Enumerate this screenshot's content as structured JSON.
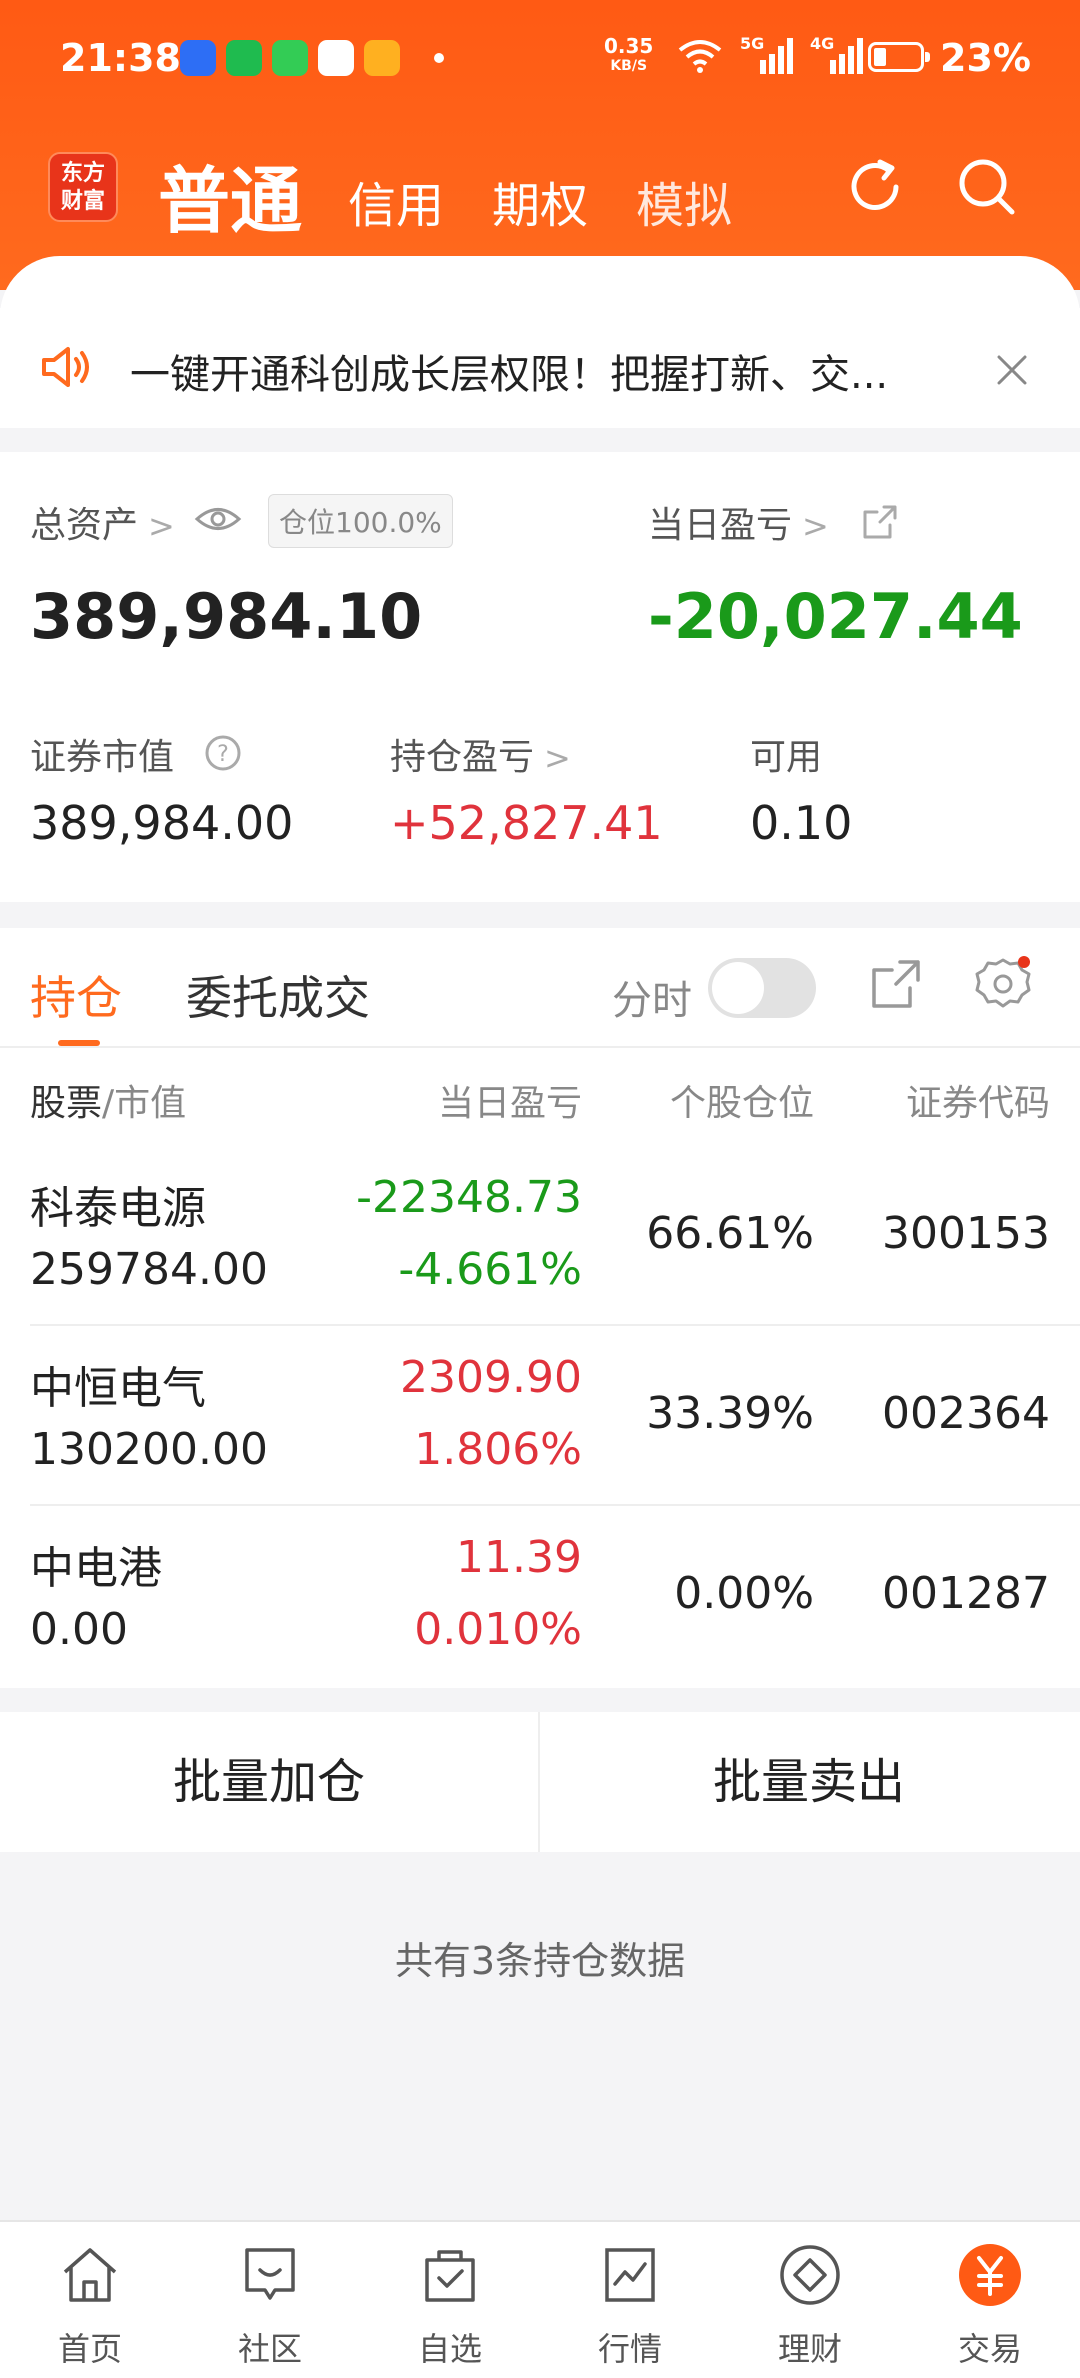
{
  "status": {
    "time": "21:38",
    "net_speed": "0.35",
    "net_unit": "KB/S",
    "sig1": "5G",
    "sig2": "4G",
    "battery": "23%"
  },
  "header": {
    "logo_line1": "东方",
    "logo_line2": "财富",
    "tabs": [
      "普通",
      "信用",
      "期权",
      "模拟"
    ]
  },
  "notice": {
    "text": "一键开通科创成长层权限！把握打新、交..."
  },
  "assets": {
    "total_label": "总资产",
    "position_badge": "仓位100.0%",
    "total_value": "389,984.10",
    "daily_pl_label": "当日盈亏",
    "daily_pl_value": "-20,027.44",
    "market_label": "证券市值",
    "market_value": "389,984.00",
    "hold_pl_label": "持仓盈亏",
    "hold_pl_value": "+52,827.41",
    "avail_label": "可用",
    "avail_value": "0.10"
  },
  "list": {
    "tab_hold": "持仓",
    "tab_orders": "委托成交",
    "timeshare": "分时",
    "col_stock": "股票",
    "col_slash": "/",
    "col_mv": "市值",
    "col_pl": "当日盈亏",
    "col_pos": "个股仓位",
    "col_code": "证券代码",
    "rows": [
      {
        "name": "科泰电源",
        "mv": "259784.00",
        "pl": "-22348.73",
        "pct": "-4.661%",
        "pos": "66.61%",
        "code": "300153"
      },
      {
        "name": "中恒电气",
        "mv": "130200.00",
        "pl": "2309.90",
        "pct": "1.806%",
        "pos": "33.39%",
        "code": "002364"
      },
      {
        "name": "中电港",
        "mv": "0.00",
        "pl": "11.39",
        "pct": "0.010%",
        "pos": "0.00%",
        "code": "001287"
      }
    ]
  },
  "actions": {
    "batch_add": "批量加仓",
    "batch_sell": "批量卖出"
  },
  "footer_text": "共有3条持仓数据",
  "nav": [
    "首页",
    "社区",
    "自选",
    "行情",
    "理财",
    "交易"
  ],
  "colors": {
    "brand": "#ff6a1e",
    "up": "#e0333c",
    "down": "#1a9a1a"
  }
}
